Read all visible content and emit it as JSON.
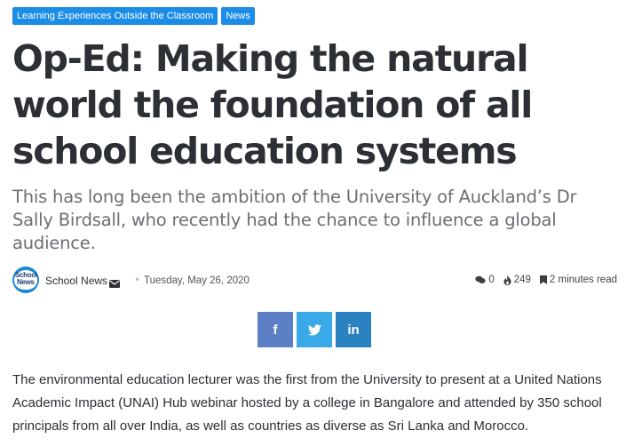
{
  "categories": [
    {
      "label": "Learning Experiences Outside the Classroom"
    },
    {
      "label": "News"
    }
  ],
  "article": {
    "title": "Op-Ed: Making the natural world the foundation of all school education systems",
    "subtitle": "This has long been the ambition of the University of Auckland’s Dr Sally Birdsall, who recently had the chance to influence a global audience.",
    "body": "The environmental education lecturer was the first from the University to present at a United Nations Academic Impact (UNAI) Hub webinar hosted by a college in Bangalore and attended by 350 school principals from all over India, as well as countries as diverse as Sri Lanka and Morocco."
  },
  "meta": {
    "avatar_line1": "School",
    "avatar_line2": "News",
    "author": "School News",
    "date": "Tuesday, May 26, 2020",
    "comments": "0",
    "views": "249",
    "read_time": "2 minutes read"
  },
  "share": {
    "facebook": "f",
    "twitter": "twitter-bird",
    "linkedin": "in"
  },
  "colors": {
    "category_bg": "#1b8de6",
    "facebook": "#5b7ec4",
    "twitter": "#3aa9e7",
    "linkedin": "#2a82c1",
    "title": "#2c2f34",
    "subtitle": "#6b6e73"
  }
}
